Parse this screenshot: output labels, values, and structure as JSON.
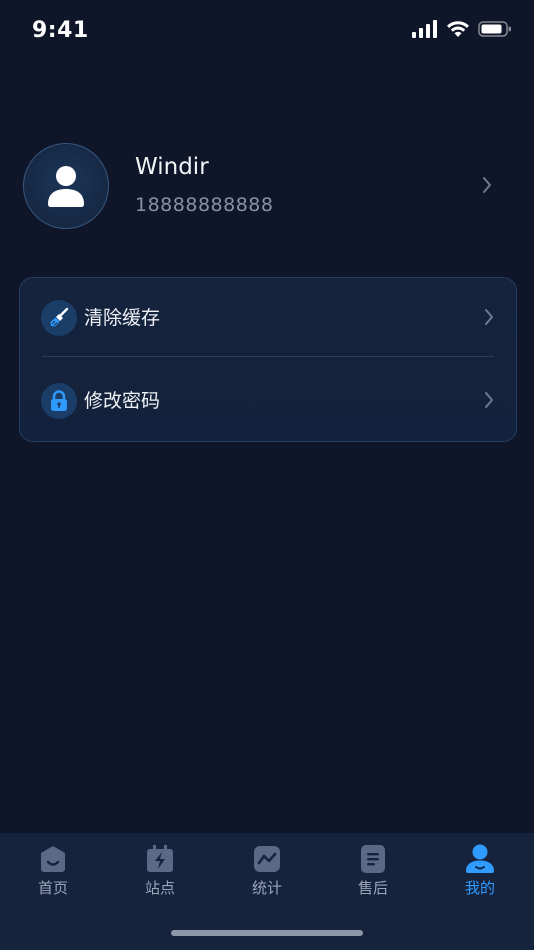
{
  "status_bar": {
    "time": "9:41"
  },
  "profile": {
    "name": "Windir",
    "phone": "18888888888"
  },
  "menu": [
    {
      "label": "清除缓存",
      "icon": "broom-icon"
    },
    {
      "label": "修改密码",
      "icon": "lock-icon"
    }
  ],
  "tabs": [
    {
      "label": "首页",
      "icon": "home-icon",
      "active": false
    },
    {
      "label": "站点",
      "icon": "charging-station-icon",
      "active": false
    },
    {
      "label": "统计",
      "icon": "statistics-icon",
      "active": false
    },
    {
      "label": "售后",
      "icon": "document-icon",
      "active": false
    },
    {
      "label": "我的",
      "icon": "user-icon",
      "active": true
    }
  ],
  "colors": {
    "background": "#0f1629",
    "active_tab": "#2f9bff",
    "inactive_tab": "#9aa6ba",
    "tabbar": "#16233d"
  }
}
